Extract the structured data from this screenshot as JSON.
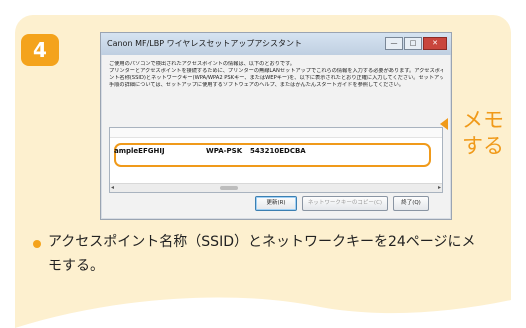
{
  "step": {
    "number": "4"
  },
  "window": {
    "title": "Canon MF/LBP ワイヤレスセットアップアシスタント",
    "controls": {
      "minimize": "—",
      "maximize": "□",
      "close": "✕"
    },
    "instructions": [
      "ご使用のパソコンで検出されたアクセスポイントの情報は、以下のとおりです。",
      "プリンターとアクセスポイントを接続するために、プリンターの無線LANセットアップでこれらの情報を入力する必要があります。アクセスポイ",
      "ント名称(SSID)とネットワークキー(WPA/WPA2 PSKキー、またはWEPキー)を、以下に表示されたとおり正確に入力してください。セットアップの方法は、プリンターのモデルによって異なる場合があります。",
      "手順の詳細については、セットアップに使用するソフトウェアのヘルプ、またはかんたんスタートガイドを参照してください。"
    ],
    "row": {
      "ssid": "ampleEFGHIJ",
      "security": "WPA-PSK",
      "key": "543210EDCBA"
    },
    "scroll": {
      "left": "◂",
      "right": "▸",
      "mid": "III"
    },
    "buttons": {
      "update": "更新(R)",
      "copy": "ネットワークキーのコピー(C)",
      "done": "終了(Q)"
    }
  },
  "callout": {
    "memo_line1": "メモ",
    "memo_line2": "する"
  },
  "bullet": {
    "text": "アクセスポイント名称（SSID）とネットワークキーを24ページにメモする。"
  },
  "colors": {
    "accent": "#f4a31c",
    "card_bg": "#fdf0cf",
    "highlight": "#f09a1a"
  }
}
